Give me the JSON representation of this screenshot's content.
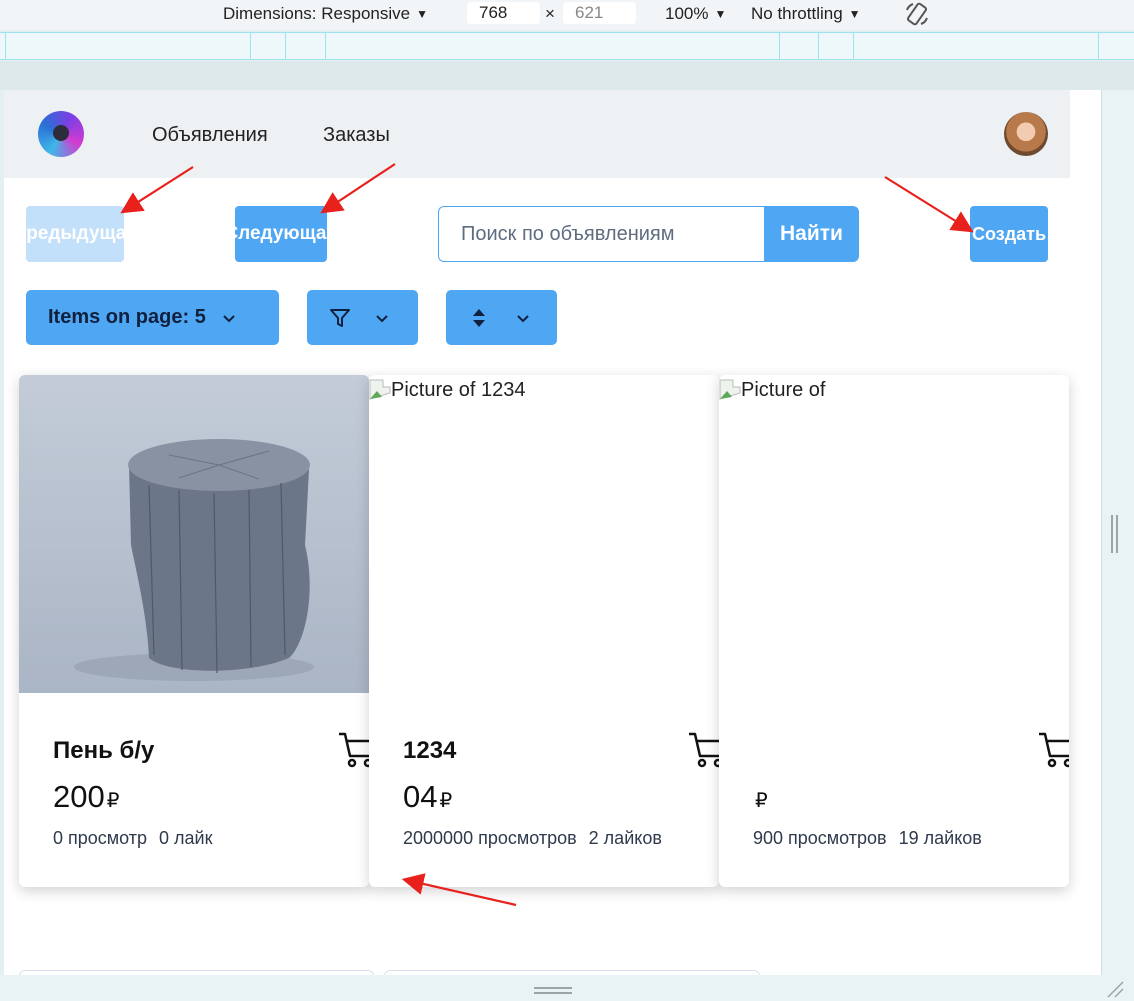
{
  "devtools": {
    "dimensions_label": "Dimensions: Responsive",
    "width_value": "768",
    "height_placeholder": "621",
    "times": "×",
    "zoom": "100%",
    "throttling": "No throttling"
  },
  "nav": {
    "links": [
      "Объявления",
      "Заказы"
    ]
  },
  "pagination": {
    "prev_label": "Предыдущая",
    "next_label": "Следующая"
  },
  "search": {
    "placeholder": "Поиск по объявлениям",
    "button_label": "Найти"
  },
  "create_label": "Создать",
  "controls": {
    "items_on_page": "Items on page: 5"
  },
  "currency": "₽",
  "cards": [
    {
      "image_alt": "",
      "title": "Пень б/у",
      "price": "200",
      "views": "0 просмотр",
      "likes": "0 лайк"
    },
    {
      "image_alt": "Picture of 1234",
      "title": "1234",
      "price": "04",
      "views": "2000000 просмотров",
      "likes": "2 лайков"
    },
    {
      "image_alt": "Picture of",
      "title": "",
      "price": "",
      "views": "900 просмотров",
      "likes": "19 лайков"
    }
  ],
  "colors": {
    "primary": "#4fa6f2",
    "primary_disabled": "#c2e0fa",
    "navbar_bg": "#edf1f4",
    "annotation_arrow": "#e8211c"
  }
}
